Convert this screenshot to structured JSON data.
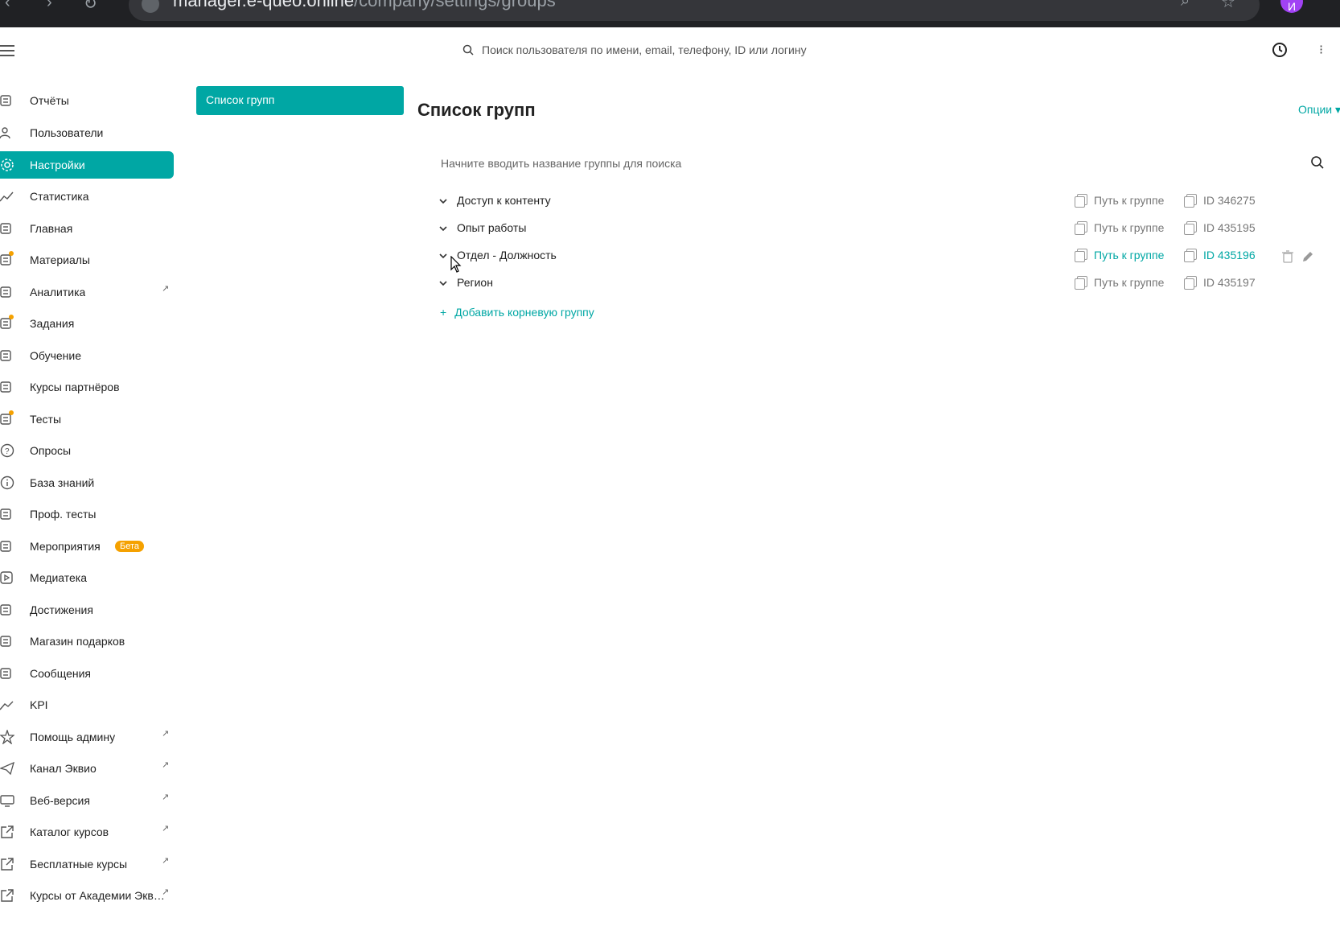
{
  "browser": {
    "url_host": "manager.e-queo.online",
    "url_path": "/company/settings/groups",
    "profile_initial": "И"
  },
  "header": {
    "search_placeholder": "Поиск пользователя по имени, email, телефону, ID или логину",
    "more_label": "⁝"
  },
  "sidebar": {
    "items": [
      {
        "label": "Отчёты",
        "icon": "report-icon"
      },
      {
        "label": "Пользователи",
        "icon": "users-icon"
      },
      {
        "label": "Настройки",
        "icon": "gear-icon",
        "active": true
      },
      {
        "label": "Статистика",
        "icon": "chart-line-icon"
      },
      {
        "label": "Главная",
        "icon": "home-icon"
      },
      {
        "label": "Материалы",
        "icon": "materials-icon",
        "dot": true
      },
      {
        "label": "Аналитика",
        "icon": "analytics-icon",
        "external": true
      },
      {
        "label": "Задания",
        "icon": "tasks-icon",
        "dot": true
      },
      {
        "label": "Обучение",
        "icon": "learning-icon"
      },
      {
        "label": "Курсы партнёров",
        "icon": "graduation-cap-icon"
      },
      {
        "label": "Тесты",
        "icon": "tests-icon",
        "dot": true
      },
      {
        "label": "Опросы",
        "icon": "question-icon"
      },
      {
        "label": "База знаний",
        "icon": "info-icon"
      },
      {
        "label": "Проф. тесты",
        "icon": "user-check-icon"
      },
      {
        "label": "Мероприятия",
        "icon": "calendar-icon",
        "badge": "Бета"
      },
      {
        "label": "Медиатека",
        "icon": "play-icon"
      },
      {
        "label": "Достижения",
        "icon": "trophy-icon"
      },
      {
        "label": "Магазин подарков",
        "icon": "gift-icon"
      },
      {
        "label": "Сообщения",
        "icon": "chat-icon"
      },
      {
        "label": "KPI",
        "icon": "trend-icon"
      },
      {
        "label": "Помощь админу",
        "icon": "star-icon",
        "external": true
      },
      {
        "label": "Канал Эквио",
        "icon": "telegram-icon",
        "external": true
      },
      {
        "label": "Веб-версия",
        "icon": "monitor-icon",
        "external": true
      },
      {
        "label": "Каталог курсов",
        "icon": "external-link-icon",
        "external": true
      },
      {
        "label": "Бесплатные курсы",
        "icon": "external-link-icon",
        "external": true
      },
      {
        "label": "Курсы от Академии Эквио",
        "icon": "external-link-icon",
        "external": true
      }
    ]
  },
  "side_panel": {
    "button_label": "Список групп"
  },
  "main": {
    "title": "Список групп",
    "options_label": "Опции",
    "group_search_placeholder": "Начните вводить название группы для поиска",
    "groups": [
      {
        "name": "Доступ к контенту",
        "path_label": "Путь к группе",
        "id_label": "ID 346275"
      },
      {
        "name": "Опыт работы",
        "path_label": "Путь к группе",
        "id_label": "ID 435195"
      },
      {
        "name": "Отдел - Должность",
        "path_label": "Путь к группе",
        "id_label": "ID 435196",
        "hovered": true
      },
      {
        "name": "Регион",
        "path_label": "Путь к группе",
        "id_label": "ID 435197"
      }
    ],
    "add_root_label": "Добавить корневую группу",
    "add_root_symbol": "+"
  },
  "colors": {
    "accent": "#00a7a4",
    "badge": "#f5a100",
    "text": "#222222",
    "muted": "#777777"
  }
}
